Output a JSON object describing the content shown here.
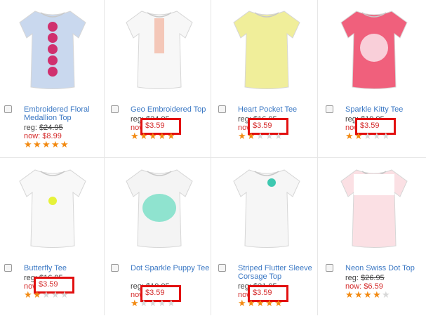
{
  "products": [
    {
      "title": "Embroidered Floral Medallion Top",
      "reg_label": "reg:",
      "reg_price": "$24.95",
      "now_label": "now:",
      "now_price": "$8.99",
      "rating": 5,
      "color": "#c9d8ee",
      "highlighted": false
    },
    {
      "title": "Geo Embroidered Top",
      "reg_label": "reg:",
      "reg_price": "$24.95",
      "now_label": "now:",
      "now_price": "$3.59",
      "rating": 5,
      "color": "#f7f7f7",
      "highlighted": true
    },
    {
      "title": "Heart Pocket Tee",
      "reg_label": "reg:",
      "reg_price": "$16.95",
      "now_label": "now:",
      "now_price": "$3.59",
      "rating": 2,
      "color": "#f0ee9a",
      "highlighted": true
    },
    {
      "title": "Sparkle Kitty Tee",
      "reg_label": "reg:",
      "reg_price": "$19.95",
      "now_label": "now:",
      "now_price": "$3.59",
      "rating": 2,
      "color": "#f0607c",
      "highlighted": true
    },
    {
      "title": "Butterfly Tee",
      "reg_label": "reg:",
      "reg_price": "$16.95",
      "now_label": "now:",
      "now_price": "$3.59",
      "rating": 2,
      "color": "#f8f8f8",
      "highlighted": true
    },
    {
      "title": "Dot Sparkle Puppy Tee",
      "reg_label": "reg:",
      "reg_price": "$19.95",
      "now_label": "now:",
      "now_price": "$3.59",
      "rating": 1,
      "color": "#f4f4f4",
      "highlighted": true
    },
    {
      "title": "Striped Flutter Sleeve Corsage Top",
      "reg_label": "reg:",
      "reg_price": "$21.95",
      "now_label": "now:",
      "now_price": "$3.59",
      "rating": 5,
      "color": "#f6f6f6",
      "highlighted": true
    },
    {
      "title": "Neon Swiss Dot Top",
      "reg_label": "reg:",
      "reg_price": "$26.95",
      "now_label": "now:",
      "now_price": "$6.59",
      "rating": 3.5,
      "color": "#fbe0e4",
      "highlighted": false
    }
  ]
}
